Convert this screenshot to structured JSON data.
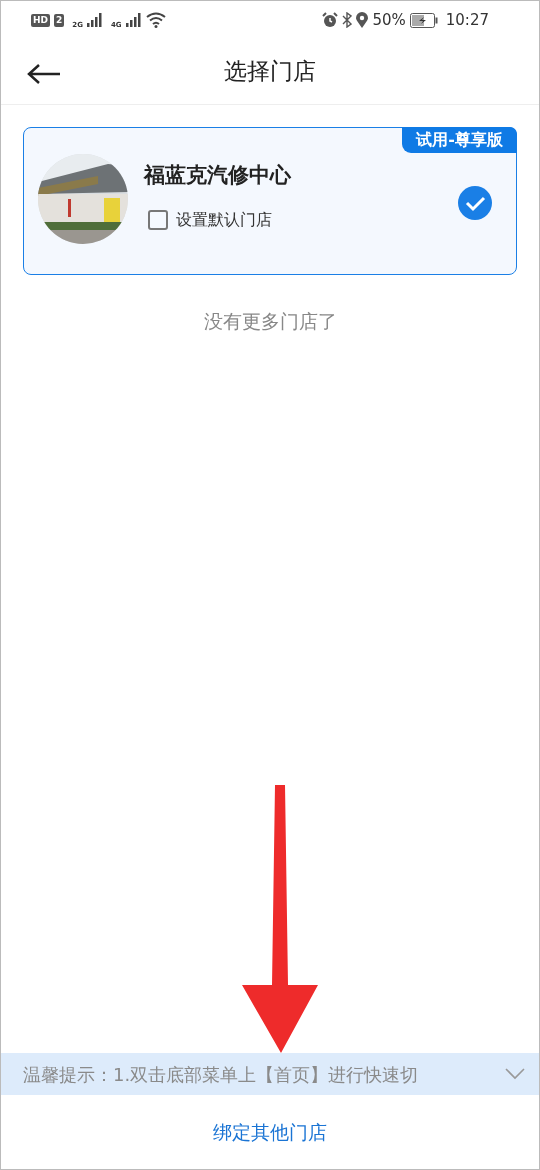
{
  "status_bar": {
    "sim_badges": [
      "HD",
      "2"
    ],
    "networks": [
      "2G",
      "4G"
    ],
    "battery": "50%",
    "time": "10:27"
  },
  "header": {
    "title": "选择门店"
  },
  "stores": [
    {
      "name": "福蓝克汽修中心",
      "badge": "试用-尊享版",
      "default_label": "设置默认门店",
      "default_checked": false,
      "selected": true
    }
  ],
  "end_note": "没有更多门店了",
  "tip": {
    "text": "温馨提示：1.双击底部菜单上【首页】进行快速切",
    "expanded": false
  },
  "bind_button": "绑定其他门店"
}
